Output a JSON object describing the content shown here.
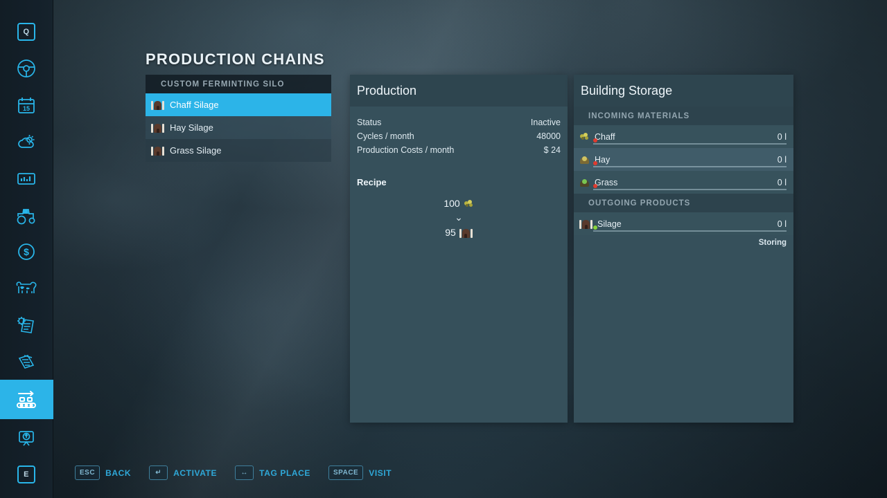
{
  "page": {
    "title": "PRODUCTION CHAINS"
  },
  "sidebar": {
    "items": [
      {
        "name": "help-key",
        "icon": "q-key-icon",
        "label": "Q",
        "selected": false
      },
      {
        "name": "vehicle-steering",
        "icon": "steering-wheel-icon",
        "label": "",
        "selected": false
      },
      {
        "name": "calendar",
        "icon": "calendar-icon",
        "label": "15",
        "selected": false
      },
      {
        "name": "weather",
        "icon": "weather-icon",
        "label": "",
        "selected": false
      },
      {
        "name": "statistics",
        "icon": "chart-icon",
        "label": "",
        "selected": false
      },
      {
        "name": "vehicles",
        "icon": "tractor-icon",
        "label": "",
        "selected": false
      },
      {
        "name": "finances",
        "icon": "dollar-coin-icon",
        "label": "",
        "selected": false
      },
      {
        "name": "animals",
        "icon": "cow-icon",
        "label": "",
        "selected": false
      },
      {
        "name": "contracts",
        "icon": "gear-document-icon",
        "label": "",
        "selected": false
      },
      {
        "name": "documents",
        "icon": "documents-icon",
        "label": "",
        "selected": false
      },
      {
        "name": "production-chains",
        "icon": "conveyor-belt-icon",
        "label": "",
        "selected": true
      },
      {
        "name": "map-overview",
        "icon": "map-screen-icon",
        "label": "",
        "selected": false
      },
      {
        "name": "extra-key",
        "icon": "e-key-icon",
        "label": "E",
        "selected": false
      }
    ]
  },
  "production_list": {
    "header": "CUSTOM FERMINTING SILO",
    "items": [
      {
        "label": "Chaff Silage",
        "icon": "silo-icon",
        "selected": true
      },
      {
        "label": "Hay Silage",
        "icon": "silo-icon",
        "selected": false
      },
      {
        "label": "Grass Silage",
        "icon": "silo-icon",
        "selected": false
      }
    ]
  },
  "production": {
    "title": "Production",
    "stats": [
      {
        "label": "Status",
        "value": "Inactive"
      },
      {
        "label": "Cycles / month",
        "value": "48000"
      },
      {
        "label": "Production Costs / month",
        "value": "$ 24"
      }
    ],
    "recipe": {
      "title": "Recipe",
      "input": {
        "amount": "100",
        "icon": "chaff-icon"
      },
      "arrow": "⌄",
      "output": {
        "amount": "95",
        "icon": "silo-icon"
      }
    }
  },
  "storage": {
    "title": "Building Storage",
    "incoming": {
      "header": "INCOMING MATERIALS",
      "items": [
        {
          "name": "Chaff",
          "amount": "0 l",
          "icon": "chaff-icon",
          "fill": 0,
          "status": "low"
        },
        {
          "name": "Hay",
          "amount": "0 l",
          "icon": "hay-icon",
          "fill": 0,
          "status": "low"
        },
        {
          "name": "Grass",
          "amount": "0 l",
          "icon": "grass-icon",
          "fill": 0,
          "status": "low"
        }
      ]
    },
    "outgoing": {
      "header": "OUTGOING PRODUCTS",
      "items": [
        {
          "name": "Silage",
          "amount": "0 l",
          "icon": "silo-icon",
          "fill": 0,
          "status": "ok"
        }
      ],
      "note": "Storing"
    }
  },
  "helpbar": {
    "items": [
      {
        "key": "ESC",
        "label": "BACK"
      },
      {
        "key": "↵",
        "label": "ACTIVATE"
      },
      {
        "key": "↔",
        "label": "TAG PLACE"
      },
      {
        "key": "SPACE",
        "label": "VISIT"
      }
    ]
  },
  "colors": {
    "accent": "#2cb4e8",
    "panel": "#36505b",
    "panel_head": "#2e454f",
    "status_low": "#e03b2f",
    "status_ok": "#8bd63b"
  }
}
